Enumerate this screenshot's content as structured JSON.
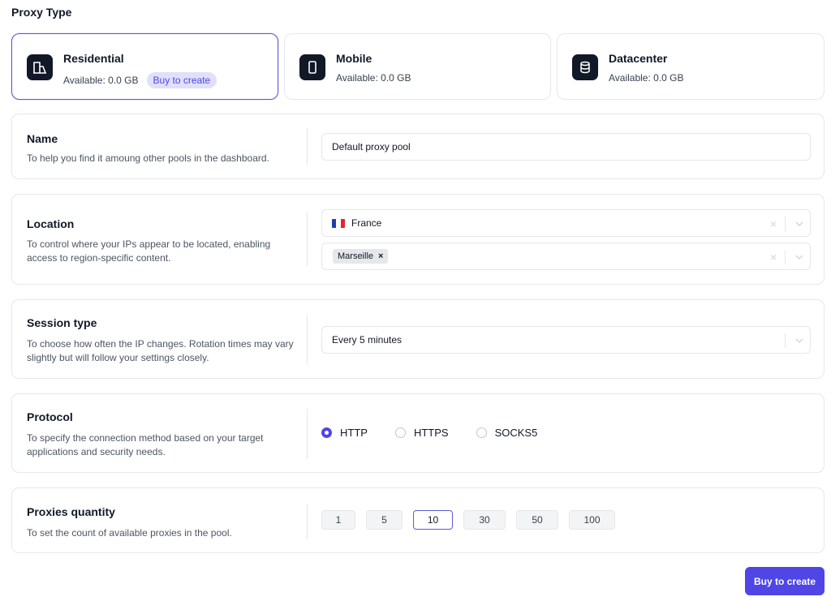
{
  "section_title": "Proxy Type",
  "proxy_types": [
    {
      "name": "Residential",
      "available": "Available: 0.0 GB",
      "badge": "Buy to create",
      "selected": true,
      "icon": "residential-icon"
    },
    {
      "name": "Mobile",
      "available": "Available: 0.0 GB",
      "selected": false,
      "icon": "mobile-icon"
    },
    {
      "name": "Datacenter",
      "available": "Available: 0.0 GB",
      "selected": false,
      "icon": "database-icon"
    }
  ],
  "name_section": {
    "title": "Name",
    "description": "To help you find it amoung other pools in the dashboard.",
    "value": "Default proxy pool"
  },
  "location_section": {
    "title": "Location",
    "description": "To control where your IPs appear to be located, enabling access to region-specific content.",
    "country": "France",
    "country_flag": "france-flag",
    "city_chip": "Marseille",
    "chip_remove": "×",
    "clear_glyph": "×"
  },
  "session_section": {
    "title": "Session type",
    "description": "To choose how often the IP changes. Rotation times may vary slightly but will follow your settings closely.",
    "value": "Every 5 minutes"
  },
  "protocol_section": {
    "title": "Protocol",
    "description": "To specify the connection method based on your target applications and security needs.",
    "options": [
      "HTTP",
      "HTTPS",
      "SOCKS5"
    ],
    "selected": "HTTP"
  },
  "quantity_section": {
    "title": "Proxies quantity",
    "description": "To set the count of available proxies in the pool.",
    "options": [
      "1",
      "5",
      "10",
      "30",
      "50",
      "100"
    ],
    "selected": "10"
  },
  "footer": {
    "buy_label": "Buy to create"
  },
  "colors": {
    "accent": "#4f46e5",
    "icon_bg": "#111827",
    "pill_bg": "#e0e0fb"
  }
}
